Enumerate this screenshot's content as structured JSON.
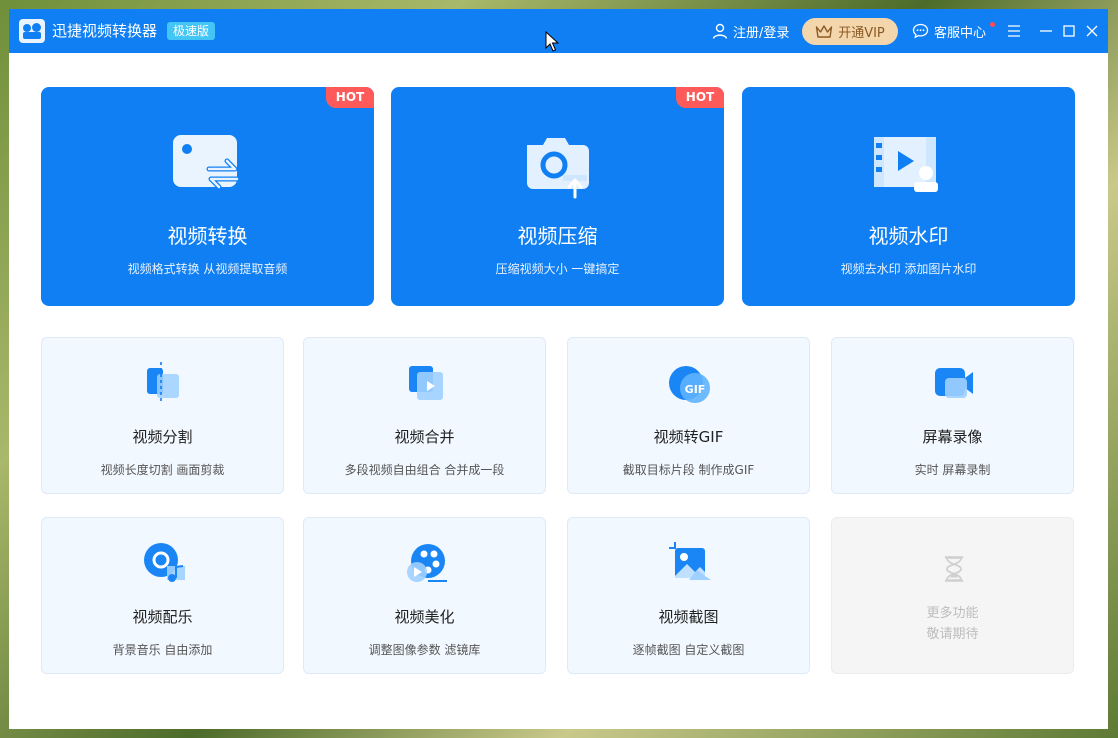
{
  "app": {
    "title": "迅捷视频转换器",
    "edition": "极速版",
    "accent_color": "#0f7ff3"
  },
  "header": {
    "login_label": "注册/登录",
    "vip_label": "开通VIP",
    "service_label": "客服中心"
  },
  "feature_cards": [
    {
      "title": "视频转换",
      "desc": "视频格式转换 从视频提取音频",
      "badge": "HOT",
      "icon": "video-convert-icon"
    },
    {
      "title": "视频压缩",
      "desc": "压缩视频大小 一键搞定",
      "badge": "HOT",
      "icon": "video-compress-icon"
    },
    {
      "title": "视频水印",
      "desc": "视频去水印 添加图片水印",
      "icon": "video-watermark-icon"
    }
  ],
  "tools": [
    {
      "title": "视频分割",
      "desc": "视频长度切割 画面剪裁",
      "icon": "video-split-icon"
    },
    {
      "title": "视频合并",
      "desc": "多段视频自由组合 合并成一段",
      "icon": "video-merge-icon"
    },
    {
      "title": "视频转GIF",
      "desc": "截取目标片段 制作成GIF",
      "icon": "gif-icon"
    },
    {
      "title": "屏幕录像",
      "desc": "实时 屏幕录制",
      "icon": "screen-record-icon"
    },
    {
      "title": "视频配乐",
      "desc": "背景音乐 自由添加",
      "icon": "video-music-icon"
    },
    {
      "title": "视频美化",
      "desc": "调整图像参数 滤镜库",
      "icon": "video-beautify-icon"
    },
    {
      "title": "视频截图",
      "desc": "逐帧截图 自定义截图",
      "icon": "video-screenshot-icon"
    },
    {
      "title": "更多功能",
      "desc": "敬请期待",
      "icon": "hourglass-icon"
    }
  ]
}
